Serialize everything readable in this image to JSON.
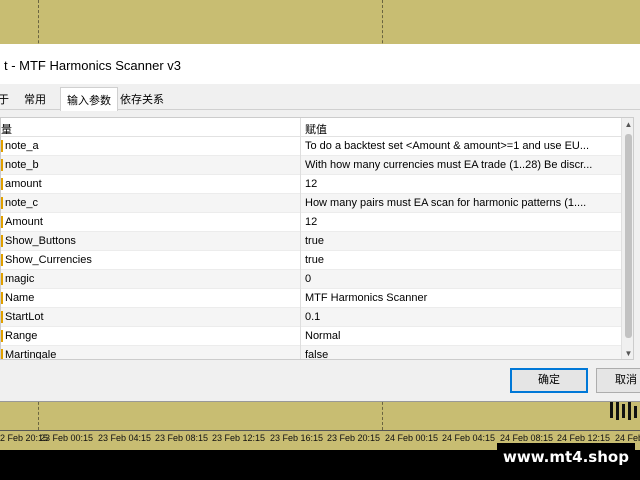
{
  "window": {
    "title": "t - MTF Harmonics Scanner v3"
  },
  "tabs": [
    {
      "label": "于"
    },
    {
      "label": "常用"
    },
    {
      "label": "输入参数"
    },
    {
      "label": "依存关系"
    }
  ],
  "grid": {
    "header": {
      "variable": "量",
      "value": "赋值"
    },
    "rows": [
      {
        "name": "note_a",
        "value": "To do a backtest set <Amount & amount>=1 and use EU..."
      },
      {
        "name": "note_b",
        "value": "With how many currencies must EA trade (1..28) Be discr..."
      },
      {
        "name": "amount",
        "value": "12"
      },
      {
        "name": "note_c",
        "value": "How many pairs must EA scan for harmonic patterns (1...."
      },
      {
        "name": "Amount",
        "value": "12"
      },
      {
        "name": "Show_Buttons",
        "value": "true"
      },
      {
        "name": "Show_Currencies",
        "value": "true"
      },
      {
        "name": "magic",
        "value": "0"
      },
      {
        "name": "Name",
        "value": "MTF Harmonics Scanner"
      },
      {
        "name": "StartLot",
        "value": "0.1"
      },
      {
        "name": "Range",
        "value": "Normal"
      },
      {
        "name": "Martingale",
        "value": "false"
      }
    ]
  },
  "buttons": {
    "ok": "确定",
    "cancel": "取消"
  },
  "chart_axis": {
    "ticks": [
      "2 Feb 20:15",
      "23 Feb 00:15",
      "23 Feb 04:15",
      "23 Feb 08:15",
      "23 Feb 12:15",
      "23 Feb 16:15",
      "23 Feb 20:15",
      "24 Feb 00:15",
      "24 Feb 04:15",
      "24 Feb 08:15",
      "24 Feb 12:15",
      "24 Feb 16:15",
      "24 Feb 2"
    ]
  },
  "watermark": "www.mt4.shop",
  "colors": {
    "chart_bg": "#c8bd72",
    "accent": "#0078d7"
  }
}
